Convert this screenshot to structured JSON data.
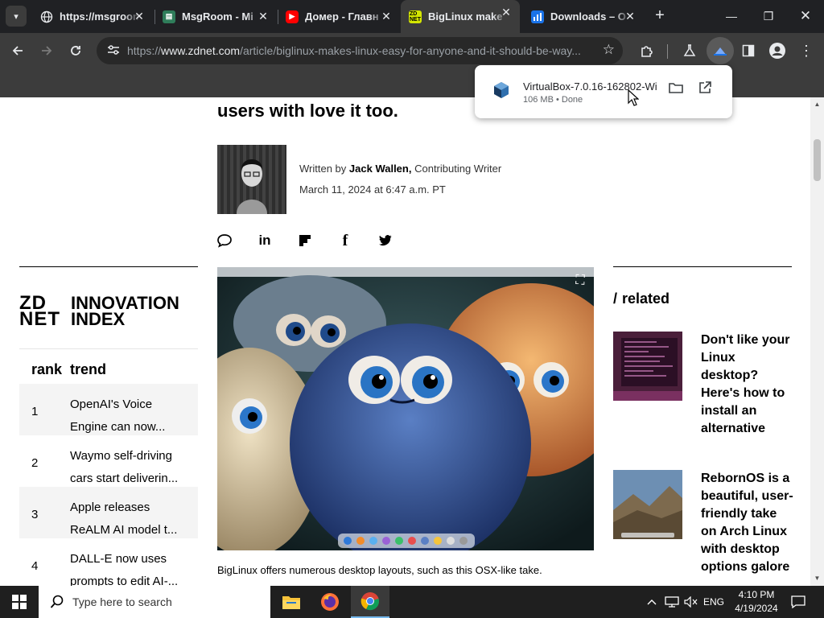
{
  "browser": {
    "tabs": [
      {
        "title": "https://msgroom",
        "favicon": "globe-icon",
        "active": false
      },
      {
        "title": "MsgRoom - Mi",
        "favicon": "msgroom-icon",
        "active": false
      },
      {
        "title": "Домер - Главн",
        "favicon": "youtube-icon",
        "active": false
      },
      {
        "title": "BigLinux make",
        "favicon": "zdnet-icon",
        "active": true
      },
      {
        "title": "Downloads – O",
        "favicon": "chart-icon",
        "active": false
      }
    ],
    "url_prefix": "https://",
    "url_domain": "www.zdnet.com",
    "url_path": "/article/biglinux-makes-linux-easy-for-anyone-and-it-should-be-way..."
  },
  "download": {
    "filename": "VirtualBox-7.0.16-162802-Wi",
    "status": "106 MB • Done"
  },
  "article": {
    "headline": "users with love it too.",
    "byline_prefix": "Written by",
    "author": "Jack Wallen,",
    "author_role": "Contributing Writer",
    "date": "March 11, 2024 at 6:47 a.m. PT",
    "caption": "BigLinux offers numerous desktop layouts, such as this OSX-like take."
  },
  "innovation": {
    "logo_top": "ZD",
    "logo_bottom": "NET",
    "title_line1": "INNOVATION",
    "title_line2": "INDEX",
    "col_rank": "rank",
    "col_trend": "trend",
    "rows": [
      {
        "rank": "1",
        "trend": "OpenAI's Voice Engine can now..."
      },
      {
        "rank": "2",
        "trend": "Waymo self-driving cars start deliverin..."
      },
      {
        "rank": "3",
        "trend": "Apple releases ReALM AI model t..."
      },
      {
        "rank": "4",
        "trend": "DALL-E now uses prompts to edit AI-..."
      }
    ]
  },
  "related": {
    "slash": "/",
    "heading": "related",
    "items": [
      {
        "title": "Don't like your Linux desktop? Here's how to install an alternative"
      },
      {
        "title": "RebornOS is a beautiful, user-friendly take on Arch Linux with desktop options galore"
      }
    ]
  },
  "taskbar": {
    "search_placeholder": "Type here to search",
    "language": "ENG",
    "time": "4:10 PM",
    "date": "4/19/2024"
  }
}
